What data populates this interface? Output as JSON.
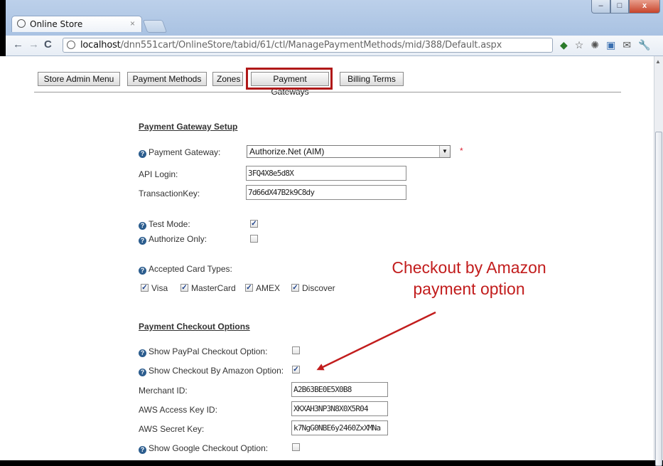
{
  "browser": {
    "tab_title": "Online Store",
    "tab_close": "×",
    "url_host": "localhost",
    "url_path": "/dnn551cart/OnlineStore/tabid/61/ctl/ManagePaymentMethods/mid/388/Default.aspx",
    "win_min": "–",
    "win_max": "□",
    "win_close": "x"
  },
  "admin_tabs": [
    "Store Admin Menu",
    "Payment Methods",
    "Zones",
    "Payment Gateways",
    "Billing Terms"
  ],
  "gateway_setup": {
    "heading": "Payment Gateway Setup",
    "gateway_label": "Payment Gateway:",
    "gateway_value": "Authorize.Net (AIM)",
    "required_marker": "*",
    "api_login_label": "API Login:",
    "api_login_value": "3FQ4X8e5d8X",
    "transaction_key_label": "TransactionKey:",
    "transaction_key_value": "7d66dX47B2k9C8dy",
    "test_mode_label": "Test Mode:",
    "test_mode_checked": true,
    "authorize_only_label": "Authorize Only:",
    "authorize_only_checked": false,
    "card_types_label": "Accepted Card Types:",
    "card_types": [
      {
        "label": "Visa",
        "checked": true
      },
      {
        "label": "MasterCard",
        "checked": true
      },
      {
        "label": "AMEX",
        "checked": true
      },
      {
        "label": "Discover",
        "checked": true
      }
    ]
  },
  "checkout_options": {
    "heading": "Payment Checkout Options",
    "paypal_label": "Show PayPal Checkout Option:",
    "paypal_checked": false,
    "amazon_label": "Show Checkout By Amazon Option:",
    "amazon_checked": true,
    "merchant_id_label": "Merchant ID:",
    "merchant_id_value": "A2B63BE0E5X0B8",
    "aws_access_label": "AWS Access Key ID:",
    "aws_access_value": "XKXAH3NP3N8X0X5R04",
    "aws_secret_label": "AWS Secret Key:",
    "aws_secret_value": "k7NgG0NBE6y2460ZxXMNa",
    "google_label": "Show Google Checkout Option:",
    "google_checked": false
  },
  "annotation": {
    "line1": "Checkout by Amazon",
    "line2": "payment option",
    "color": "#c21d1d"
  },
  "icons": [
    "back-icon",
    "forward-icon",
    "reload-icon",
    "page-icon",
    "star-icon",
    "settings-icon",
    "wrench-icon",
    "help-icon"
  ]
}
